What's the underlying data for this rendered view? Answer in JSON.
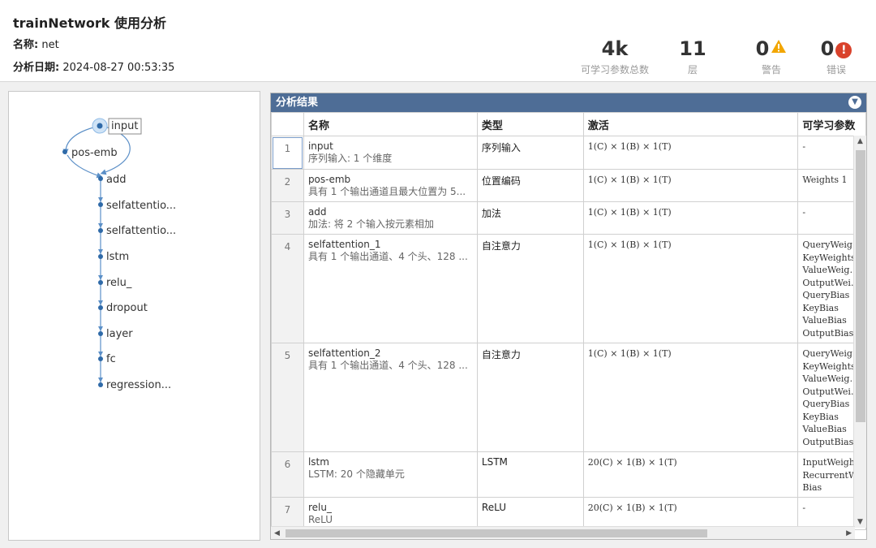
{
  "header": {
    "title": "trainNetwork 使用分析",
    "name_label": "名称:",
    "name_value": "net",
    "date_label": "分析日期:",
    "date_value": "2024-08-27 00:53:35",
    "stats": [
      {
        "value": "4k",
        "label": "可学习参数总数"
      },
      {
        "value": "11",
        "label": "层"
      },
      {
        "value": "0",
        "label": "警告"
      },
      {
        "value": "0",
        "label": "错误"
      }
    ]
  },
  "graph": {
    "nodes": [
      "input",
      "pos-emb",
      "add",
      "selfattentio...",
      "selfattentio...",
      "lstm",
      "relu_",
      "dropout",
      "layer",
      "fc",
      "regression..."
    ]
  },
  "results": {
    "title": "分析结果",
    "columns": [
      "名称",
      "类型",
      "激活",
      "可学习参数"
    ],
    "rows": [
      {
        "idx": "1",
        "name": "input",
        "desc": "序列输入: 1 个维度",
        "type": "序列输入",
        "act": "1(C) × 1(B) × 1(T)",
        "params": [
          "-"
        ]
      },
      {
        "idx": "2",
        "name": "pos-emb",
        "desc": "具有 1 个输出通道且最大位置为 5...",
        "type": "位置编码",
        "act": "1(C) × 1(B) × 1(T)",
        "params": [
          "Weights  1"
        ]
      },
      {
        "idx": "3",
        "name": "add",
        "desc": "加法: 将 2 个输入按元素相加",
        "type": "加法",
        "act": "1(C) × 1(B) × 1(T)",
        "params": [
          "-"
        ]
      },
      {
        "idx": "4",
        "name": "selfattention_1",
        "desc": "具有 1 个输出通道、4 个头、128 ...",
        "type": "自注意力",
        "act": "1(C) × 1(B) × 1(T)",
        "params": [
          "QueryWeig…",
          "KeyWeights",
          "ValueWeig…",
          "OutputWei…",
          "QueryBias",
          "KeyBias",
          "ValueBias",
          "OutputBias"
        ]
      },
      {
        "idx": "5",
        "name": "selfattention_2",
        "desc": "具有 1 个输出通道、4 个头、128 ...",
        "type": "自注意力",
        "act": "1(C) × 1(B) × 1(T)",
        "params": [
          "QueryWeig…",
          "KeyWeights",
          "ValueWeig…",
          "OutputWei…",
          "QueryBias",
          "KeyBias",
          "ValueBias",
          "OutputBias"
        ]
      },
      {
        "idx": "6",
        "name": "lstm",
        "desc": "LSTM: 20 个隐藏单元",
        "type": "LSTM",
        "act": "20(C) × 1(B) × 1(T)",
        "params": [
          "InputWeigh",
          "RecurrentW",
          "Bias"
        ]
      },
      {
        "idx": "7",
        "name": "relu_",
        "desc": "ReLU",
        "type": "ReLU",
        "act": "20(C) × 1(B) × 1(T)",
        "params": [
          "-"
        ]
      }
    ]
  },
  "colors": {
    "titlebar": "#4e6d96",
    "warning": "#f2a600",
    "error": "#d9422b",
    "graph": "#5b8fc7"
  }
}
